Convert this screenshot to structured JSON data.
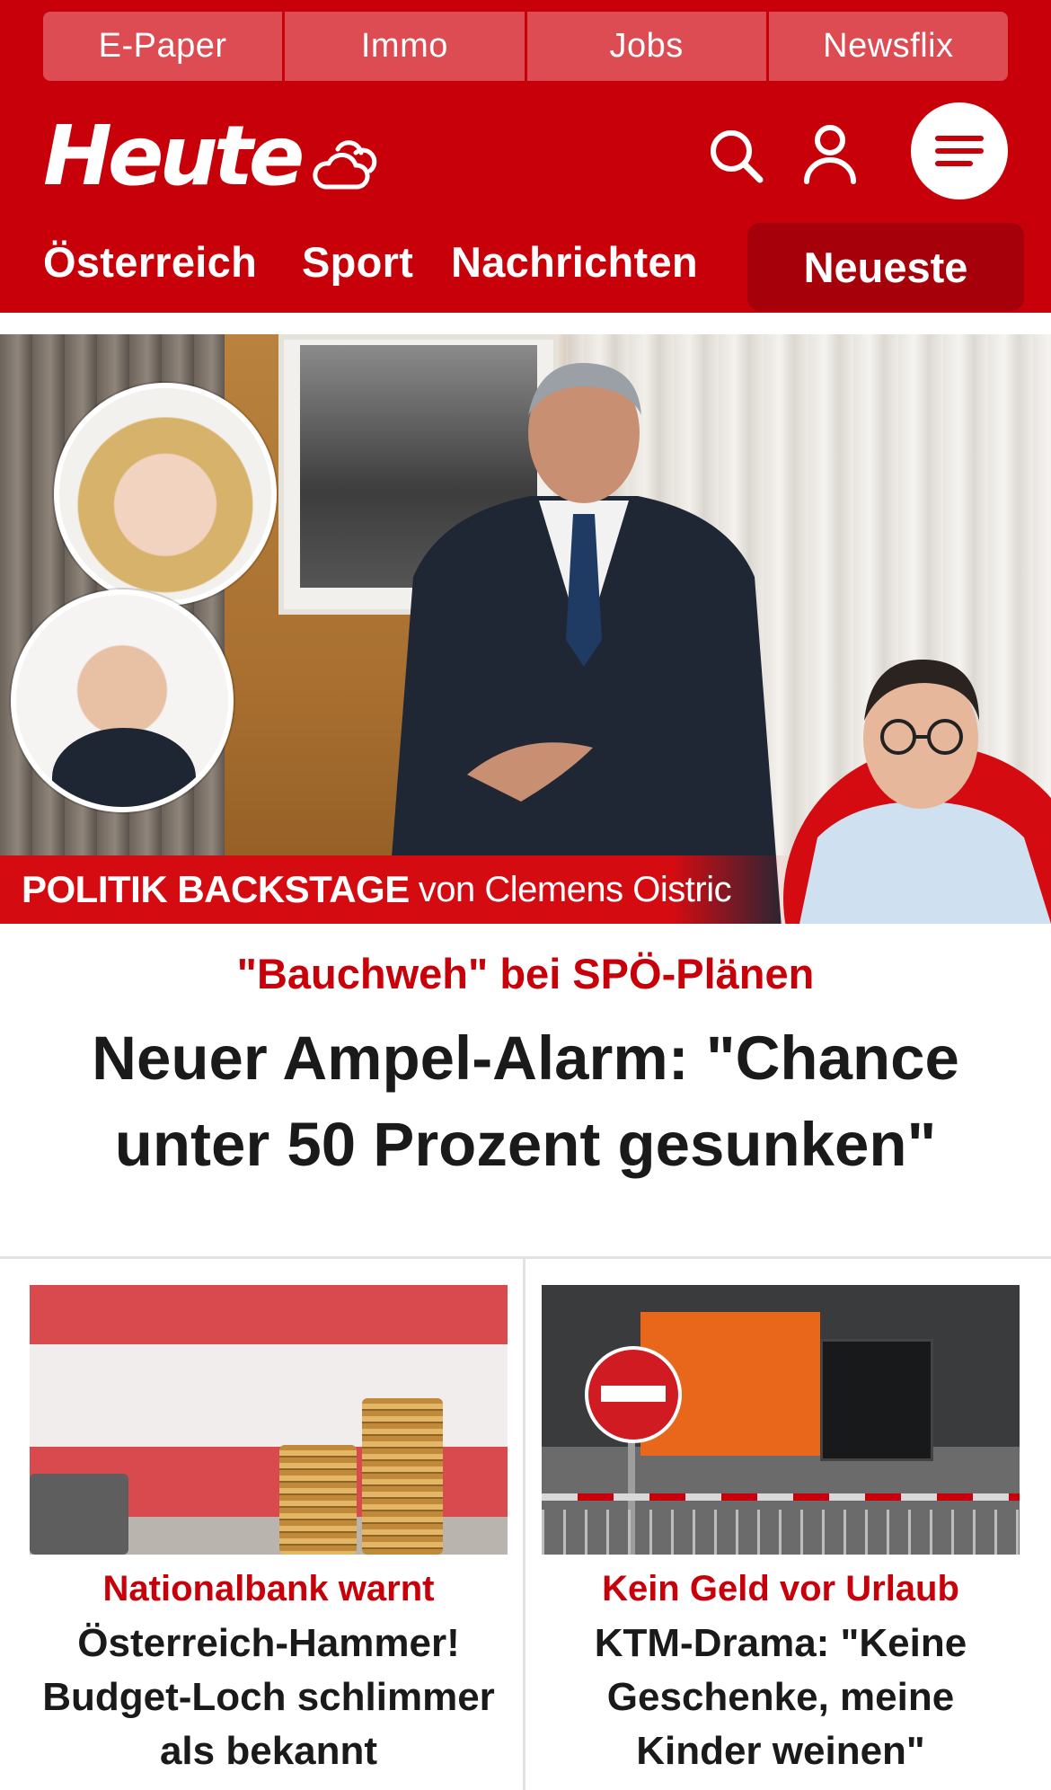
{
  "quick_links": [
    "E-Paper",
    "Immo",
    "Jobs",
    "Newsflix"
  ],
  "brand": {
    "logo": "Heute"
  },
  "icons": {
    "weather": "weather-cloud-icon",
    "search": "search-icon",
    "account": "user-icon",
    "menu": "menu-icon"
  },
  "nav": {
    "items": [
      "Österreich",
      "Sport",
      "Nachrichten"
    ],
    "active": "Neueste"
  },
  "hero": {
    "banner_bold": "POLITIK BACKSTAGE",
    "banner_rest": "von Clemens Oistric"
  },
  "lead": {
    "kicker": "\"Bauchweh\" bei SPÖ-Plänen",
    "title": "Neuer Ampel-Alarm: \"Chance unter 50 Prozent gesunken\""
  },
  "teasers": [
    {
      "kicker": "Nationalbank warnt",
      "title": "Österreich-Hammer! Budget-Loch schlimmer als bekannt"
    },
    {
      "kicker": "Kein Geld vor Urlaub",
      "title": "KTM-Drama: \"Keine Geschenke, meine Kinder weinen\""
    }
  ],
  "colors": {
    "brand_red": "#c8000a",
    "nav_active": "#a6000a",
    "quicklink_bg": "#de4c53"
  }
}
